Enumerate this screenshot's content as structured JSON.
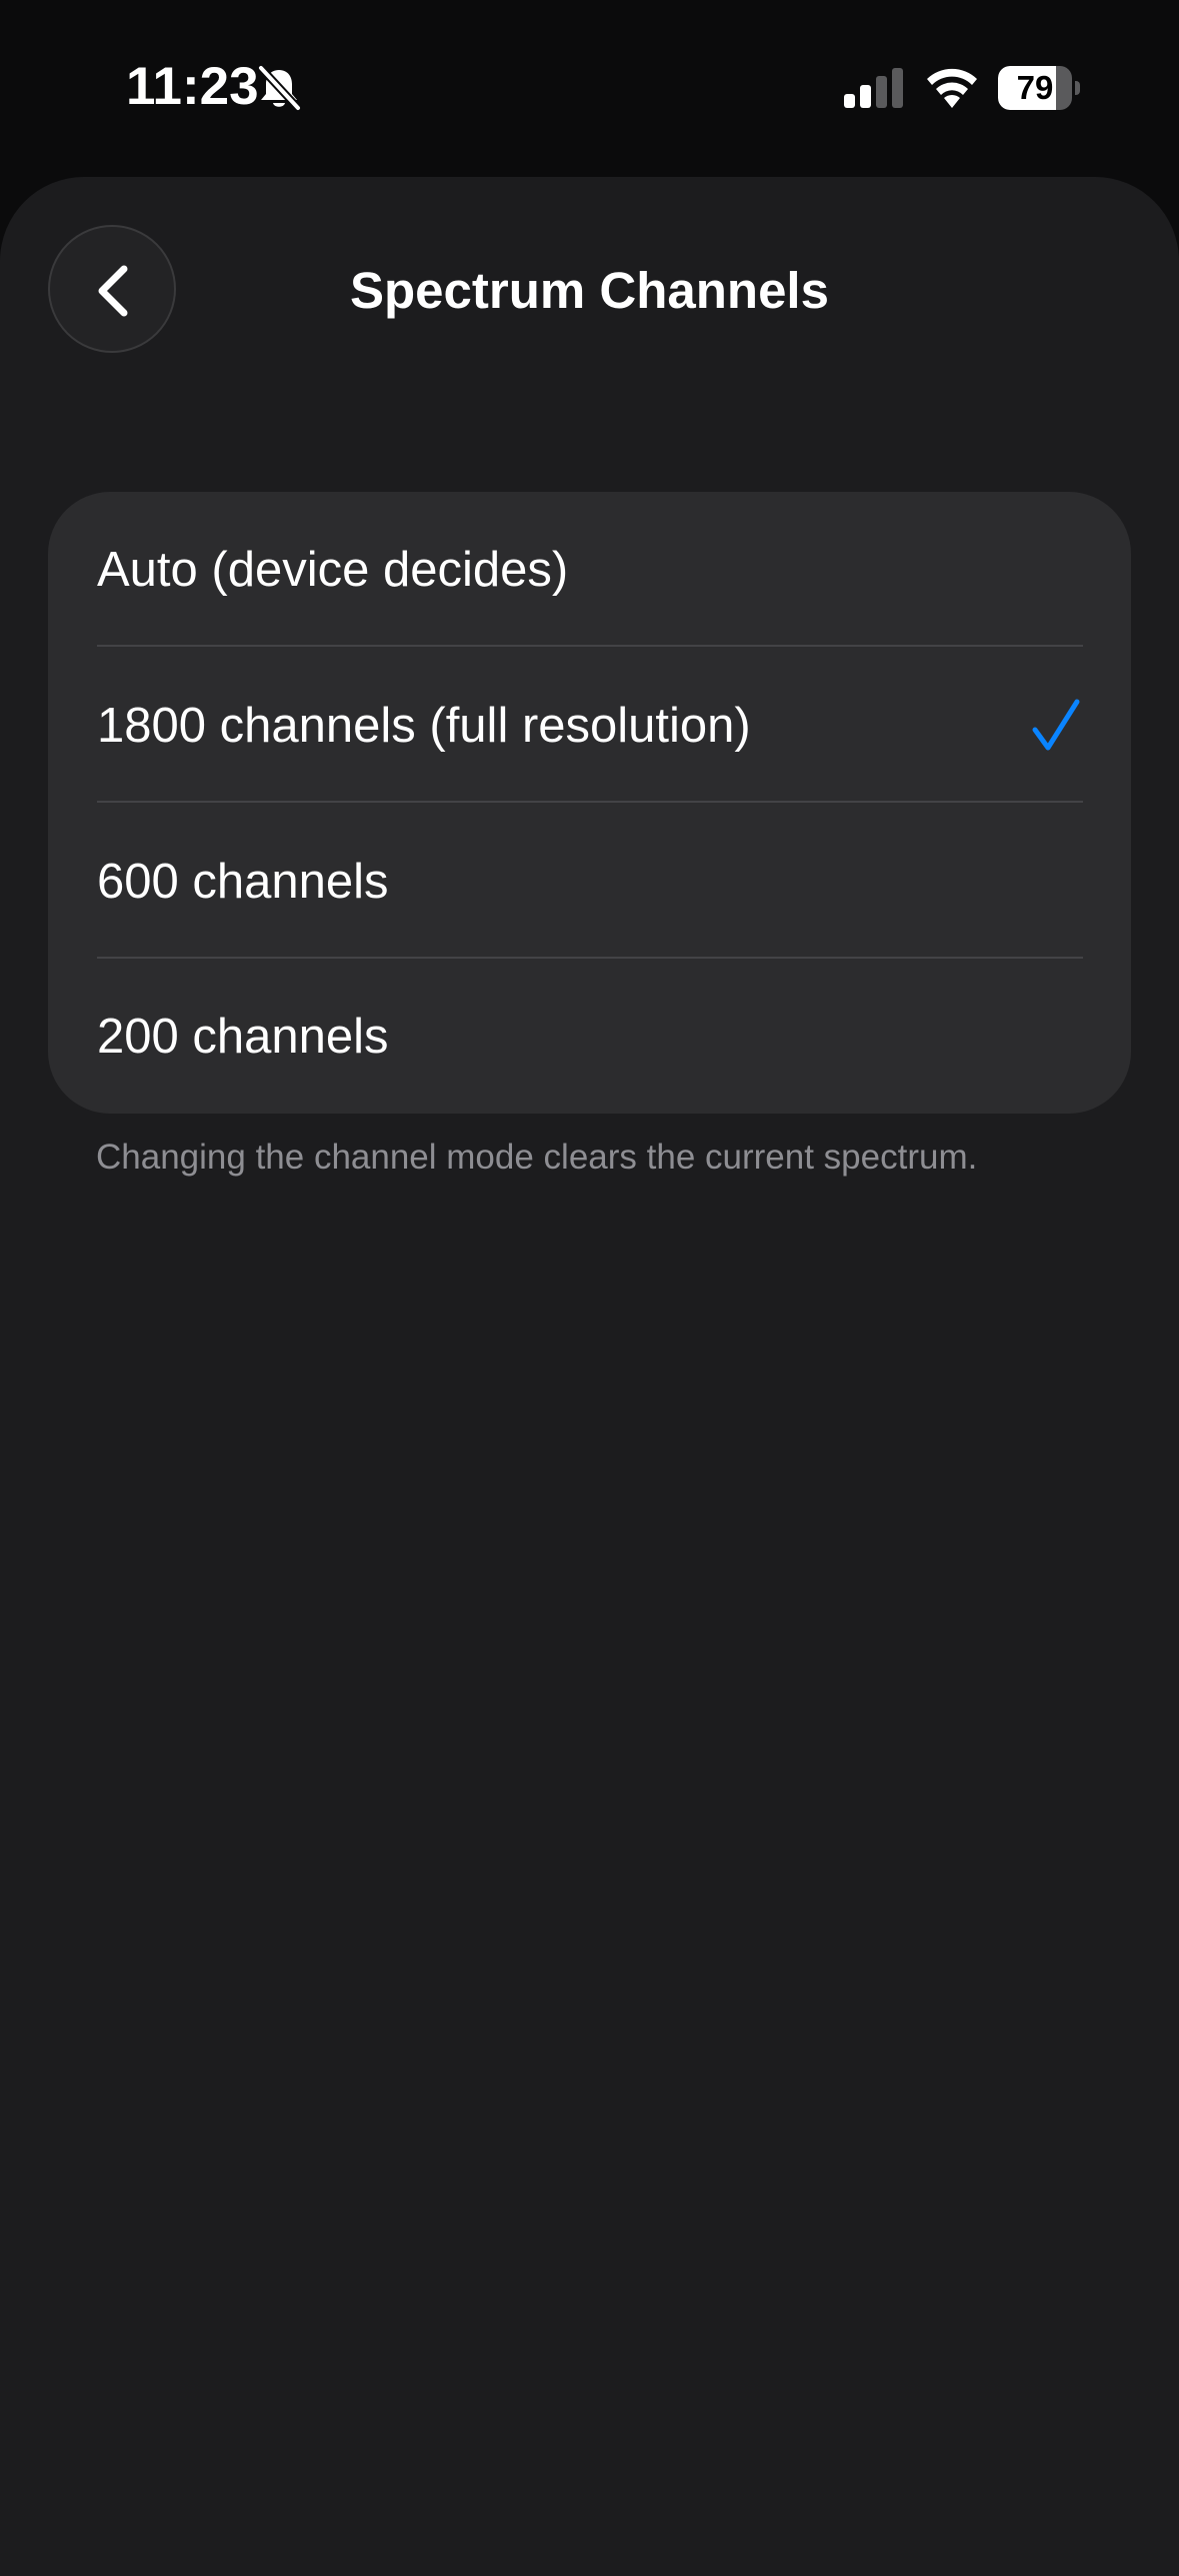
{
  "status_bar": {
    "time": "11:23",
    "silent_mode": true,
    "signal_bars_active": 2,
    "signal_bars_total": 4,
    "battery_level": "79",
    "battery_fraction": 0.79
  },
  "header": {
    "back_icon": "chevron-left-icon",
    "title": "Spectrum Channels"
  },
  "options": [
    {
      "label": "Auto (device decides)",
      "selected": false
    },
    {
      "label": "1800 channels (full resolution)",
      "selected": true
    },
    {
      "label": "600 channels",
      "selected": false
    },
    {
      "label": "200 channels",
      "selected": false
    }
  ],
  "footer_note": "Changing the channel mode clears the current spectrum.",
  "colors": {
    "background": "#1c1c1e",
    "card": "#2c2c2e",
    "accent": "#0a84ff",
    "secondary_text": "#8e8e93"
  }
}
